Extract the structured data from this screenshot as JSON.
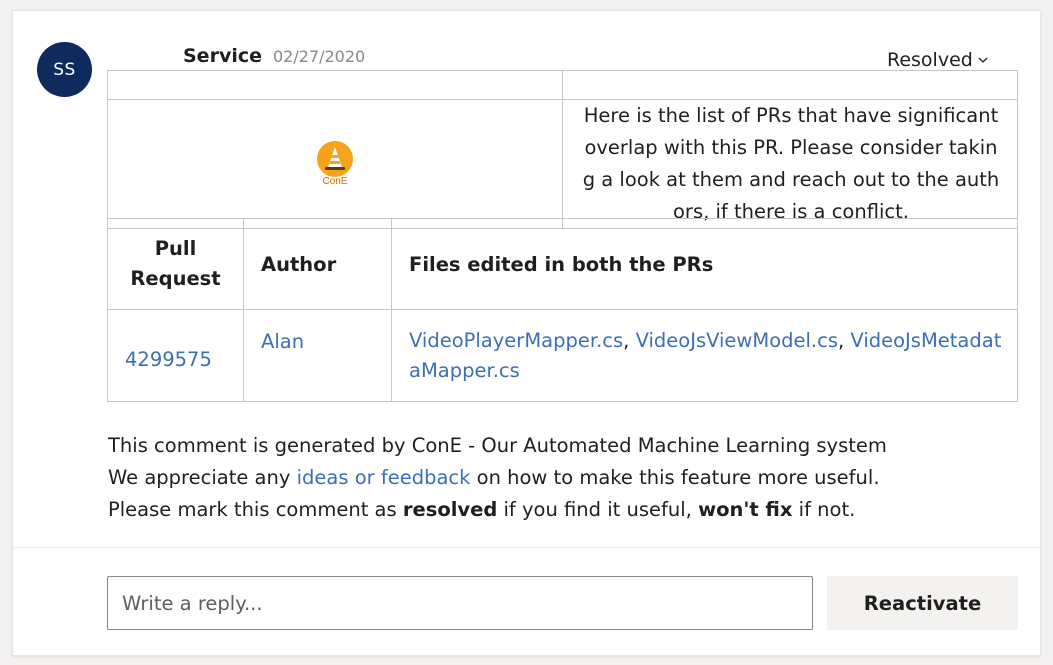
{
  "comment": {
    "avatar_initials": "SS",
    "author": "Service",
    "date": "02/27/2020",
    "status": "Resolved"
  },
  "cone": {
    "logo_label": "ConE",
    "message": "Here is the list of PRs that have significant overlap with this PR. Please consider taking a look at them and reach out to the authors, if there is a conflict."
  },
  "pr_table": {
    "headers": [
      "Pull Request",
      "Author",
      "Files edited in both the PRs"
    ],
    "rows": [
      {
        "pull_request": "4299575",
        "author": "Alan",
        "files": [
          "VideoPlayerMapper.cs",
          "VideoJsViewModel.cs",
          "VideoJsMetadataMapper.cs"
        ],
        "separator": ", "
      }
    ]
  },
  "footer": {
    "line1": "This comment is generated by ConE - Our Automated Machine Learning system",
    "line2_before": "We appreciate any ",
    "line2_link": "ideas or feedback",
    "line2_after": " on how to make this feature more useful.",
    "line3_before": "Please mark this comment as ",
    "line3_bold1": "resolved",
    "line3_mid": " if you find it useful, ",
    "line3_bold2": "won't fix",
    "line3_after": " if not."
  },
  "reply": {
    "placeholder": "Write a reply...",
    "button_label": "Reactivate"
  },
  "colors": {
    "avatar_bg": "#0f2a5c",
    "link": "#3b6fb6",
    "cone_orange": "#f7a21b"
  },
  "icons": {
    "status_chevron": "chevron-down-icon",
    "cone_logo": "traffic-cone-icon"
  }
}
